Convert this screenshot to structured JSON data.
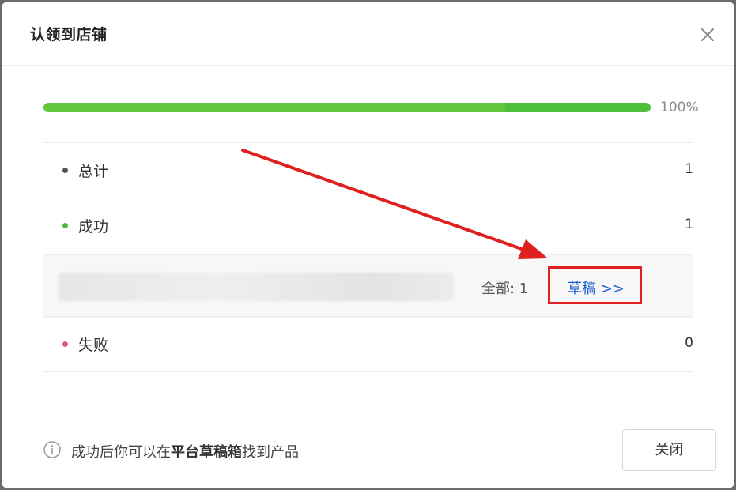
{
  "dialog": {
    "title": "认领到店铺",
    "progress": {
      "fraction": 1.0,
      "text": "100%",
      "color": "#5cc63e"
    },
    "stats": [
      {
        "label": "总计",
        "value": "1",
        "dot_color": "#555555"
      },
      {
        "label": "成功",
        "value": "1",
        "dot_color": "#4cba3b"
      },
      {
        "label": "失败",
        "value": "0",
        "dot_color": "#e05a77"
      }
    ],
    "success_detail": {
      "all_count_text": "全部: 1",
      "draft_link_text": "草稿 >>"
    },
    "footer": {
      "info_prefix": "成功后你可以在",
      "info_bold": "平台草稿箱",
      "info_suffix": "找到产品",
      "close_button": "关闭"
    },
    "icons": {
      "close": "close-icon",
      "info": "info-icon"
    },
    "annotation_color": "#e02020"
  }
}
